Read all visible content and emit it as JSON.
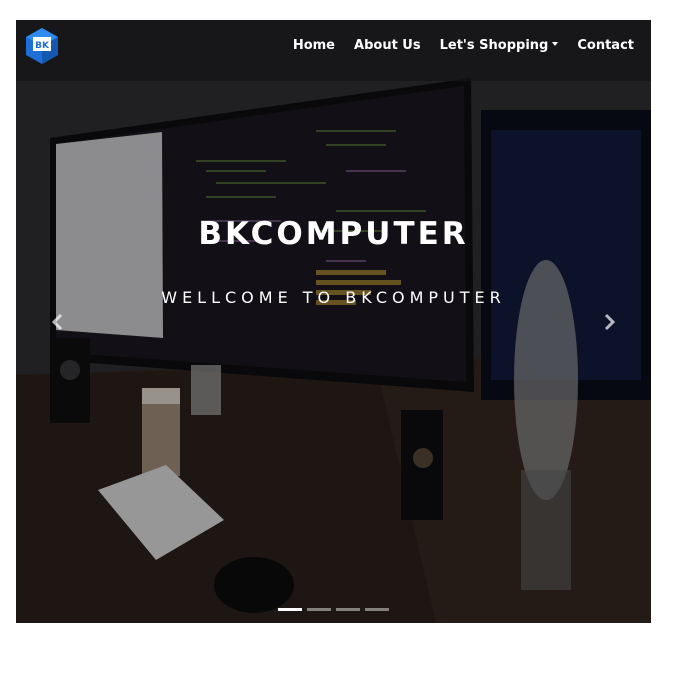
{
  "brand": {
    "logo_text": "BK",
    "icon": "bk-cube-logo-icon"
  },
  "nav": {
    "home": "Home",
    "about": "About Us",
    "shopping": "Let's Shopping",
    "contact": "Contact"
  },
  "hero": {
    "title": "BKCOMPUTER",
    "subtitle": "WELLCOME TO BKCOMPUTER"
  },
  "carousel": {
    "prev_icon": "chevron-left-icon",
    "next_icon": "chevron-right-icon",
    "slide_count": 4,
    "active_index": 0
  },
  "colors": {
    "nav_bg": "#141416",
    "logo_blue": "#1d6fd6",
    "text": "#ffffff"
  }
}
